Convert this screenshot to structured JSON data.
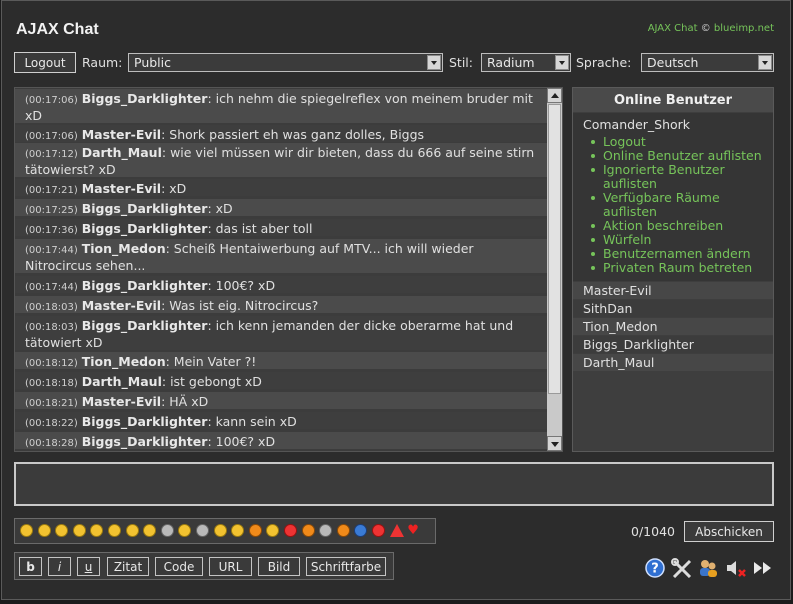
{
  "app": {
    "title": "AJAX Chat",
    "copyright_prefix": "AJAX Chat",
    "copyright_symbol": "©",
    "copyright_link": "blueimp.net"
  },
  "toolbar": {
    "logout_label": "Logout",
    "room_label": "Raum:",
    "room_value": "Public",
    "style_label": "Stil:",
    "style_value": "Radium",
    "language_label": "Sprache:",
    "language_value": "Deutsch"
  },
  "messages": [
    {
      "time": "(00:17:06)",
      "user": "Biggs_Darklighter",
      "text": "ich nehm die spiegelreflex von meinem bruder mit xD"
    },
    {
      "time": "(00:17:06)",
      "user": "Master-Evil",
      "text": "Shork passiert eh was ganz dolles, Biggs"
    },
    {
      "time": "(00:17:12)",
      "user": "Darth_Maul",
      "text": "wie viel müssen wir dir bieten, dass du 666 auf seine stirn tätowierst? xD"
    },
    {
      "time": "(00:17:21)",
      "user": "Master-Evil",
      "text": "xD"
    },
    {
      "time": "(00:17:25)",
      "user": "Biggs_Darklighter",
      "text": "xD"
    },
    {
      "time": "(00:17:36)",
      "user": "Biggs_Darklighter",
      "text": "das ist aber toll"
    },
    {
      "time": "(00:17:44)",
      "user": "Tion_Medon",
      "text": "Scheiß Hentaiwerbung auf MTV... ich will wieder Nitrocircus sehen..."
    },
    {
      "time": "(00:17:44)",
      "user": "Biggs_Darklighter",
      "text": "100€? xD"
    },
    {
      "time": "(00:18:03)",
      "user": "Master-Evil",
      "text": "Was ist eig. Nitrocircus?"
    },
    {
      "time": "(00:18:03)",
      "user": "Biggs_Darklighter",
      "text": "ich kenn jemanden der dicke oberarme hat und tätowiert xD"
    },
    {
      "time": "(00:18:12)",
      "user": "Tion_Medon",
      "text": "Mein Vater ?!"
    },
    {
      "time": "(00:18:18)",
      "user": "Darth_Maul",
      "text": "ist gebongt xD"
    },
    {
      "time": "(00:18:21)",
      "user": "Master-Evil",
      "text": "HÄ xD"
    },
    {
      "time": "(00:18:22)",
      "user": "Biggs_Darklighter",
      "text": "kann sein xD"
    },
    {
      "time": "(00:18:28)",
      "user": "Biggs_Darklighter",
      "text": "100€? xD"
    }
  ],
  "online": {
    "title": "Online Benutzer",
    "self_name": "Comander_Shork",
    "actions": [
      "Logout",
      "Online Benutzer auflisten",
      "Ignorierte Benutzer auflisten",
      "Verfügbare Räume auflisten",
      "Aktion beschreiben",
      "Würfeln",
      "Benutzernamen ändern",
      "Privaten Raum betreten"
    ],
    "users": [
      "Master-Evil",
      "SithDan",
      "Tion_Medon",
      "Biggs_Darklighter",
      "Darth_Maul"
    ]
  },
  "input": {
    "counter": "0/1040",
    "send_label": "Abschicken"
  },
  "bbcode": [
    "b",
    "i",
    "u",
    "Zitat",
    "Code",
    "URL",
    "Bild",
    "Schriftfarbe"
  ],
  "emoticons": [
    "smile-icon",
    "wink-icon",
    "grin-icon",
    "tongue-icon",
    "laugh-icon",
    "neutral-icon",
    "surprised-icon",
    "blank-icon",
    "nerd-icon",
    "cool-icon",
    "sunglasses-icon",
    "blush-icon",
    "cry-icon",
    "shout-icon",
    "grimace-icon",
    "devil-icon",
    "monkey-icon",
    "lightbulb-icon",
    "exclamation-icon",
    "question-icon",
    "stop-icon",
    "warning-icon",
    "heart-icon"
  ],
  "colors": {
    "link_green": "#76c45a",
    "panel": "#3e3e3e",
    "background": "#2c2c2c"
  }
}
